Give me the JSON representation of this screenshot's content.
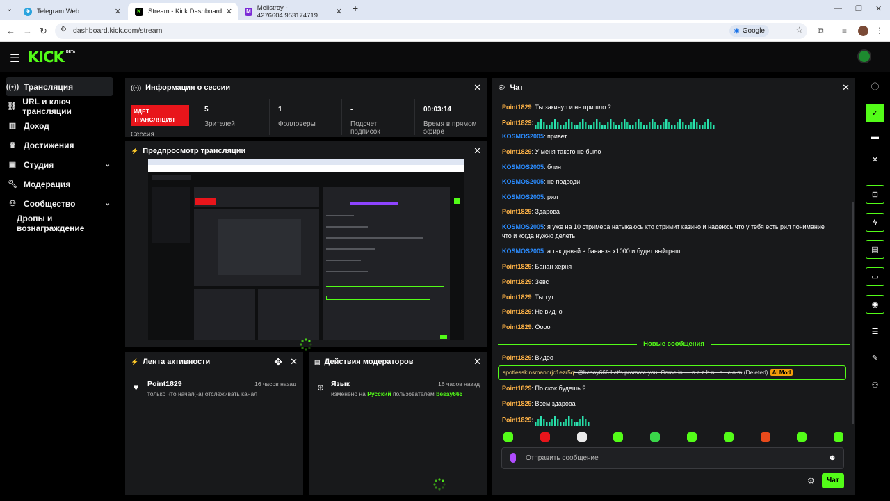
{
  "browser": {
    "tabs": [
      {
        "title": "Telegram Web",
        "color": "#2aa3de",
        "glyph": "✈"
      },
      {
        "title": "Stream - Kick Dashboard",
        "color": "#53fc18",
        "glyph": "K"
      },
      {
        "title": "Mellstroy - 4276604.953174719",
        "color": "#7b2bd6",
        "glyph": "M"
      }
    ],
    "url": "dashboard.kick.com/stream",
    "search_engine": "Google"
  },
  "header": {
    "logo": "KICK",
    "beta": "BETA"
  },
  "sidebar": {
    "items": [
      {
        "label": "Трансляция",
        "icon": "broadcast-icon",
        "glyph": "((•))"
      },
      {
        "label": "URL и ключ трансляции",
        "icon": "link-icon",
        "glyph": "🔗"
      },
      {
        "label": "Доход",
        "icon": "chart-icon",
        "glyph": "▥"
      },
      {
        "label": "Достижения",
        "icon": "trophy-icon",
        "glyph": "🏆"
      },
      {
        "label": "Студия",
        "icon": "studio-icon",
        "glyph": "▣"
      },
      {
        "label": "Модерация",
        "icon": "wrench-icon",
        "glyph": "🔧"
      },
      {
        "label": "Сообщество",
        "icon": "community-icon",
        "glyph": "👥"
      },
      {
        "label": "Дропы и вознаграждение"
      }
    ]
  },
  "session": {
    "title": "Информация о сессии",
    "live_badge": "ИДЕТ ТРАНСЛЯЦИЯ",
    "live_sub": "Сессия",
    "stats": [
      {
        "value": "5",
        "label": "Зрителей"
      },
      {
        "value": "1",
        "label": "Фолловеры"
      },
      {
        "value": "-",
        "label": "Подсчет подписок"
      },
      {
        "value": "00:03:14",
        "label": "Время в прямом эфире"
      }
    ]
  },
  "preview": {
    "title": "Предпросмотр трансляции"
  },
  "activity": {
    "title": "Лента активности",
    "items": [
      {
        "name": "Point1829",
        "time": "16 часов назад",
        "desc": "только что начал(-а) отслеживать канал"
      }
    ]
  },
  "mod_actions": {
    "title": "Действия модераторов",
    "items": [
      {
        "name": "Язык",
        "time": "16 часов назад",
        "pre": "изменено на",
        "value": "Русский",
        "mid": "пользователем",
        "user": "besay666"
      }
    ]
  },
  "chat": {
    "title": "Чат",
    "messages": [
      {
        "user": "Point1829",
        "color": "orange",
        "text": ": Ты закинул и не пришло ?"
      },
      {
        "user": "Point1829",
        "color": "orange",
        "text": ":",
        "emote_bars": 13
      },
      {
        "user": "KOSMOS2005",
        "color": "blue",
        "text": ": привет"
      },
      {
        "user": "Point1829",
        "color": "orange",
        "text": ": У меня такого не было"
      },
      {
        "user": "KOSMOS2005",
        "color": "blue",
        "text": ": блин"
      },
      {
        "user": "KOSMOS2005",
        "color": "blue",
        "text": ": не подводи"
      },
      {
        "user": "KOSMOS2005",
        "color": "blue",
        "text": ": рил"
      },
      {
        "user": "Point1829",
        "color": "orange",
        "text": ": Здарова"
      },
      {
        "user": "KOSMOS2005",
        "color": "blue",
        "text": ": я уже на 10 стримера натыкаюсь кто стримит казино и надеюсь что у тебя есть рил понимание что и когда нужно делеть"
      },
      {
        "user": "KOSMOS2005",
        "color": "blue",
        "text": ": а так давай в бананза х1000 и будет выйграш"
      },
      {
        "user": "Point1829",
        "color": "orange",
        "text": ": Банан херня"
      },
      {
        "user": "Point1829",
        "color": "orange",
        "text": ": Зевс"
      },
      {
        "user": "Point1829",
        "color": "orange",
        "text": ": Ты тут"
      },
      {
        "user": "Point1829",
        "color": "orange",
        "text": ": Не видно"
      },
      {
        "user": "Point1829",
        "color": "orange",
        "text": ": Оооо"
      }
    ],
    "new_messages_label": "Новые сообщения",
    "after": [
      {
        "user": "Point1829",
        "color": "orange",
        "text": ": Видео"
      },
      {
        "user": "Point1829",
        "color": "orange",
        "text": ": По скок будешь ?"
      },
      {
        "user": "Point1829",
        "color": "orange",
        "text": ": Всем здарова"
      },
      {
        "user": "Point1829",
        "color": "orange",
        "text": ":",
        "emote_bars": 4
      }
    ],
    "deleted": {
      "user": "spotlesskinsmannrjc1ezr5q",
      "text": ": @besay666 Let's promote you. Come in — n e z h n . a . c o m",
      "tag": "(Deleted)",
      "badge": "AI Mod"
    },
    "input_placeholder": "Отправить сообщение",
    "send_label": "Чат"
  },
  "colors": {
    "accent": "#53fc18",
    "live": "#e8151b",
    "orange_user": "#ffb347",
    "blue_user": "#2b8cff",
    "ai_mod": "#f59e0b"
  }
}
